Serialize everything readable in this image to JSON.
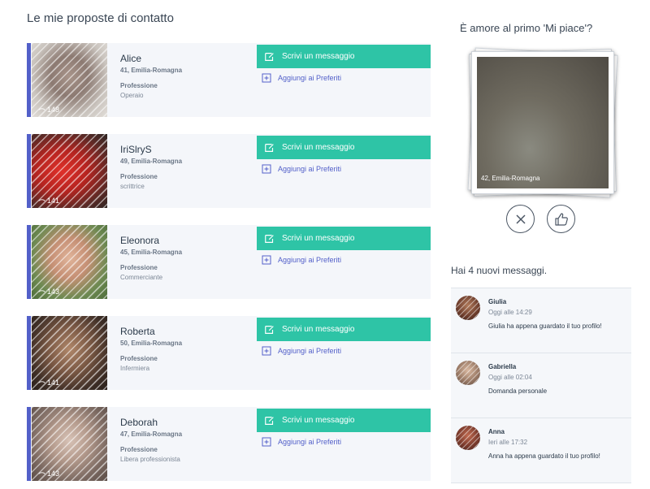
{
  "page_title": "Le mie proposte di contatto",
  "colors": {
    "accent": "#5360c9",
    "primary_button": "#2ec4a6",
    "card_bg": "#f4f6fa"
  },
  "contacts": [
    {
      "name": "Alice",
      "location": "41, Emilia-Romagna",
      "profession_label": "Professione",
      "profession": "Operaio",
      "views": "148",
      "message_label": "Scrivi un messaggio",
      "favorite_label": "Aggiungi ai Preferiti"
    },
    {
      "name": "IriSlryS",
      "location": "49, Emilia-Romagna",
      "profession_label": "Professione",
      "profession": "scrittrice",
      "views": "141",
      "message_label": "Scrivi un messaggio",
      "favorite_label": "Aggiungi ai Preferiti"
    },
    {
      "name": "Eleonora",
      "location": "45, Emilia-Romagna",
      "profession_label": "Professione",
      "profession": "Commerciante",
      "views": "143",
      "message_label": "Scrivi un messaggio",
      "favorite_label": "Aggiungi ai Preferiti"
    },
    {
      "name": "Roberta",
      "location": "50, Emilia-Romagna",
      "profession_label": "Professione",
      "profession": "Infermiera",
      "views": "141",
      "message_label": "Scrivi un messaggio",
      "favorite_label": "Aggiungi ai Preferiti"
    },
    {
      "name": "Deborah",
      "location": "47, Emilia-Romagna",
      "profession_label": "Professione",
      "profession": "Libera professionista",
      "views": "143",
      "message_label": "Scrivi un messaggio",
      "favorite_label": "Aggiungi ai Preferiti"
    }
  ],
  "like_panel": {
    "title": "È amore al primo 'Mi piace'?",
    "photo_caption": "42, Emilia-Romagna",
    "reject_icon": "close-circle-icon",
    "like_icon": "thumbs-up-icon"
  },
  "messages_panel": {
    "title": "Hai 4 nuovi messaggi.",
    "items": [
      {
        "name": "Giulia",
        "time": "Oggi alle 14:29",
        "text": "Giulia ha appena guardato il tuo profilo!"
      },
      {
        "name": "Gabriella",
        "time": "Oggi alle 02:04",
        "text": "Domanda personale"
      },
      {
        "name": "Anna",
        "time": "Ieri alle 17:32",
        "text": "Anna ha appena guardato il tuo profilo!"
      }
    ]
  }
}
